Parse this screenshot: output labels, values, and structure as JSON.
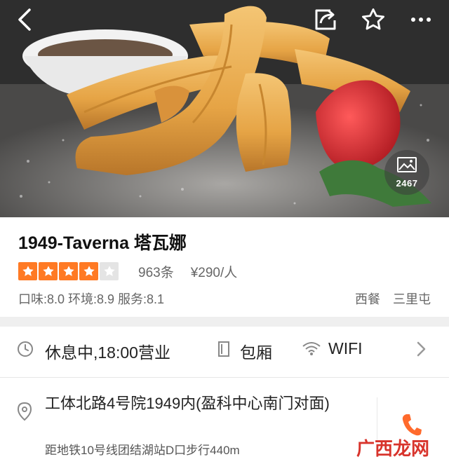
{
  "hero": {
    "gallery_count": "2467"
  },
  "icons": {
    "back": "chevron-left-icon",
    "share": "share-icon",
    "favorite": "star-outline-icon",
    "more": "more-icon",
    "gallery": "image-icon",
    "clock": "clock-icon",
    "room": "door-icon",
    "wifi": "wifi-icon",
    "chevron": "chevron-right-icon",
    "location": "location-pin-icon",
    "phone": "phone-icon"
  },
  "restaurant": {
    "name": "1949-Taverna 塔瓦娜",
    "rating_stars": 4,
    "rating_max": 5,
    "reviews": "963条",
    "price": "¥290/人",
    "scores": "口味:8.0  环境:8.9  服务:8.1",
    "tags": [
      "西餐",
      "三里屯"
    ]
  },
  "facilities": {
    "hours": "休息中,18:00营业",
    "room": "包厢",
    "wifi": "WIFI"
  },
  "address": {
    "text": "工体北路4号院1949内(盈科中心南门对面)",
    "metro": "距地铁10号线团结湖站D口步行440m"
  },
  "colors": {
    "star_active": "#ff7a24",
    "star_inactive": "#e4e4e4",
    "phone": "#ff6a2c",
    "watermark": "#d8342c"
  },
  "watermark": "广西龙网"
}
